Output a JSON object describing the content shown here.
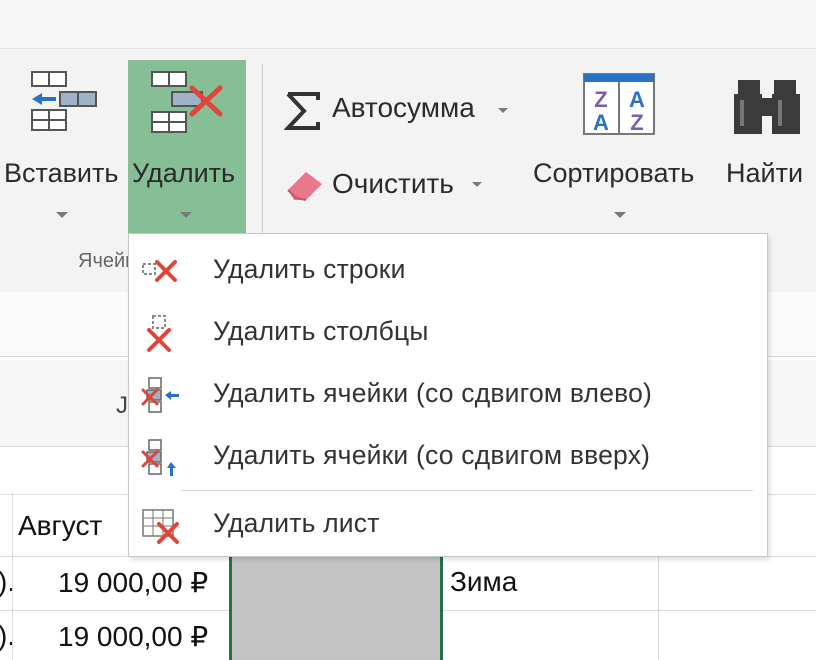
{
  "ribbon": {
    "insert_label": "Вставить",
    "delete_label": "Удалить",
    "group_label": "Ячейки",
    "autosum_label": "Автосумма",
    "clear_label": "Очистить",
    "sort_label": "Сортировать",
    "find_label": "Найти",
    "icons": {
      "insert": "insert-cells-icon",
      "delete": "delete-cells-icon",
      "autosum": "sigma-icon",
      "clear": "eraser-icon",
      "sort": "sort-az-icon",
      "find": "binoculars-icon"
    }
  },
  "sheet": {
    "partial_header": "J",
    "month_label": "Август",
    "rows": [
      {
        "prefix": ").",
        "amount": "19 000,00 ₽",
        "season": "Зима"
      },
      {
        "prefix": ").",
        "amount": "19 000,00 ₽",
        "season": ""
      }
    ]
  },
  "delete_menu": {
    "items": [
      {
        "label": "Удалить строки",
        "icon": "delete-rows-icon"
      },
      {
        "label": "Удалить столбцы",
        "icon": "delete-columns-icon"
      },
      {
        "label": "Удалить ячейки (со сдвигом влево)",
        "icon": "delete-cells-shift-left-icon"
      },
      {
        "label": "Удалить ячейки (со сдвигом вверх)",
        "icon": "delete-cells-shift-up-icon"
      },
      {
        "label": "Удалить лист",
        "icon": "delete-sheet-icon"
      }
    ]
  },
  "colors": {
    "selected_button": "#86bf95",
    "delete_x": "#e0453a",
    "selected_cell_fill": "#c3c3c3",
    "selection_border": "#217346"
  }
}
